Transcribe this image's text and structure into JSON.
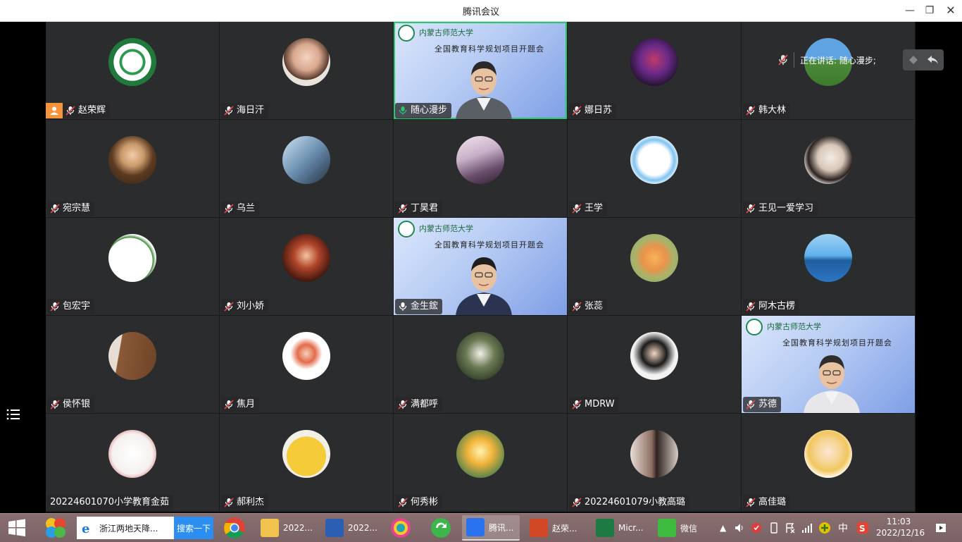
{
  "window": {
    "title": "腾讯会议",
    "minimize": "—",
    "maximize": "❐",
    "close": "✕"
  },
  "speaking": {
    "label": "正在讲话: 随心漫步;"
  },
  "banner": {
    "university": "内蒙古师范大学",
    "title": "全国教育科学规划项目开题会"
  },
  "participants": [
    {
      "name": "赵荣辉",
      "avatar": "green-logo",
      "mic": "muted",
      "host": true
    },
    {
      "name": "海日汗",
      "avatar": "girl-photo",
      "mic": "muted"
    },
    {
      "name": "随心漫步",
      "avatar": "video",
      "mic": "speaking",
      "active": true
    },
    {
      "name": "娜日苏",
      "avatar": "game-character",
      "mic": "muted"
    },
    {
      "name": "韩大林",
      "avatar": "landscape",
      "mic": "muted"
    },
    {
      "name": "宛宗慧",
      "avatar": "cartoon-girl",
      "mic": "muted"
    },
    {
      "name": "乌兰",
      "avatar": "girl-sky",
      "mic": "muted"
    },
    {
      "name": "丁昊君",
      "avatar": "anime-girl",
      "mic": "muted"
    },
    {
      "name": "王学",
      "avatar": "cartoon-cat",
      "mic": "muted"
    },
    {
      "name": "王见一爱学习",
      "avatar": "girl-plush",
      "mic": "muted"
    },
    {
      "name": "包宏宇",
      "avatar": "duck-drawing",
      "mic": "muted"
    },
    {
      "name": "刘小娇",
      "avatar": "anime-red",
      "mic": "muted"
    },
    {
      "name": "金生鋐",
      "avatar": "video",
      "mic": "on"
    },
    {
      "name": "张蕊",
      "avatar": "tiger-cartoon",
      "mic": "muted"
    },
    {
      "name": "阿木古楞",
      "avatar": "sea",
      "mic": "muted"
    },
    {
      "name": "侯怀银",
      "avatar": "wood-door",
      "mic": "muted"
    },
    {
      "name": "焦月",
      "avatar": "cartoon-girl-white",
      "mic": "muted"
    },
    {
      "name": "满都呼",
      "avatar": "boy-outdoor",
      "mic": "muted"
    },
    {
      "name": "MDRW",
      "avatar": "child-photo",
      "mic": "muted"
    },
    {
      "name": "苏德",
      "avatar": "video",
      "mic": "muted"
    },
    {
      "name": "20224601070小学教育金茹",
      "avatar": "sketch-girl",
      "mic": "none"
    },
    {
      "name": "郝利杰",
      "avatar": "cartoon-bear",
      "mic": "muted"
    },
    {
      "name": "何秀彬",
      "avatar": "dancer-sunset",
      "mic": "muted"
    },
    {
      "name": "20224601079小教高璐",
      "avatar": "girl-selfie",
      "mic": "muted"
    },
    {
      "name": "高佳璐",
      "avatar": "blonde-cartoon",
      "mic": "muted"
    }
  ],
  "taskbar": {
    "search_text": "浙江两地天降...",
    "search_button": "搜索一下",
    "apps": [
      {
        "label": "2022...",
        "icon": "folder-icon"
      },
      {
        "label": "2022...",
        "icon": "word-icon"
      },
      {
        "label": "腾讯...",
        "icon": "tencent-meeting-icon"
      },
      {
        "label": "赵荣...",
        "icon": "powerpoint-icon"
      },
      {
        "label": "Micr...",
        "icon": "excel-icon"
      },
      {
        "label": "微信",
        "icon": "wechat-icon"
      }
    ],
    "ime": "中",
    "time": "11:03",
    "date": "2022/12/16"
  }
}
